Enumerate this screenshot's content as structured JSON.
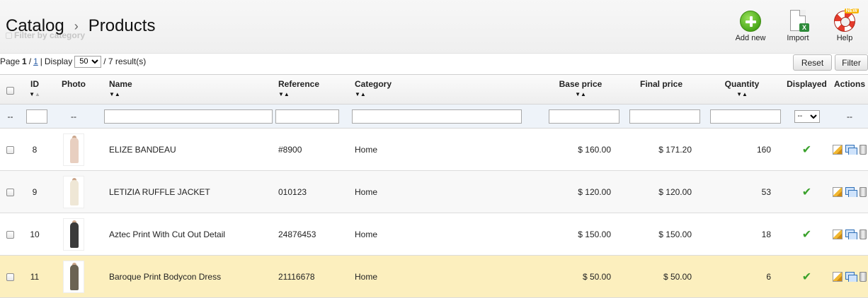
{
  "breadcrumb": {
    "parent": "Catalog",
    "separator": "›",
    "current": "Products"
  },
  "ghost_filter": "Filter by category",
  "toolbar": {
    "add_new_label": "Add new",
    "import_label": "Import",
    "import_badge": "X",
    "help_label": "Help",
    "help_badge": "NEW"
  },
  "pager": {
    "page_word": "Page",
    "current_page": "1",
    "slash": "/",
    "total_pages": "1",
    "pipe": "|",
    "display_word": "Display",
    "per_page": "50",
    "results_text": "/ 7 result(s)"
  },
  "buttons": {
    "reset": "Reset",
    "filter": "Filter"
  },
  "columns": {
    "id": "ID",
    "photo": "Photo",
    "name": "Name",
    "reference": "Reference",
    "category": "Category",
    "base_price": "Base price",
    "final_price": "Final price",
    "quantity": "Quantity",
    "displayed": "Displayed",
    "actions": "Actions"
  },
  "sort_arrows": {
    "down": "▼",
    "up": "▲"
  },
  "filter_row": {
    "placeholder_dash": "--",
    "displayed_option": "--"
  },
  "rows": [
    {
      "id": "8",
      "name": "ELIZE BANDEAU",
      "reference": "#8900",
      "category": "Home",
      "base_price": "$ 160.00",
      "final_price": "$ 171.20",
      "quantity": "160",
      "displayed": "✔",
      "photo_color": "#e8cfc0"
    },
    {
      "id": "9",
      "name": "LETIZIA RUFFLE JACKET",
      "reference": "010123",
      "category": "Home",
      "base_price": "$ 120.00",
      "final_price": "$ 120.00",
      "quantity": "53",
      "displayed": "✔",
      "photo_color": "#efe7d6"
    },
    {
      "id": "10",
      "name": "Aztec Print With Cut Out Detail",
      "reference": "24876453",
      "category": "Home",
      "base_price": "$ 150.00",
      "final_price": "$ 150.00",
      "quantity": "18",
      "displayed": "✔",
      "photo_color": "#3a3a3a"
    },
    {
      "id": "11",
      "name": "Baroque Print Bodycon Dress",
      "reference": "21116678",
      "category": "Home",
      "base_price": "$ 50.00",
      "final_price": "$ 50.00",
      "quantity": "6",
      "displayed": "✔",
      "photo_color": "#6b6353"
    }
  ],
  "colors": {
    "highlight_row": "#fcefbe",
    "filter_row_bg": "#eef3f9",
    "displayed_check": "#3aa12b",
    "link": "#2b5fa8"
  }
}
